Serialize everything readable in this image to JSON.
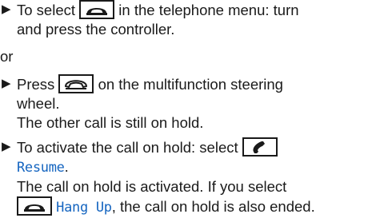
{
  "step1": {
    "bullet": "▶",
    "part1": "To select",
    "icon": "end-call-key-icon",
    "part2": "in the telephone menu: turn",
    "line2": "and press the controller."
  },
  "or_label": "or",
  "step2": {
    "bullet": "▶",
    "part1": "Press",
    "icon": "steering-wheel-end-call-icon",
    "part2": "on the multifunction steering",
    "line2": "wheel.",
    "result": "The other call is still on hold."
  },
  "step3": {
    "bullet": "▶",
    "part1": "To activate the call on hold: select",
    "icon": "phone-handset-icon",
    "command": "Resume",
    "command_suffix": ".",
    "result_line1": "The call on hold is activated. If you select",
    "result_icon": "end-call-key-icon",
    "result_command": "Hang Up",
    "result_part2": ", the call on hold is also ended."
  },
  "colors": {
    "text": "#1a1a1a",
    "command": "#1565c0"
  }
}
